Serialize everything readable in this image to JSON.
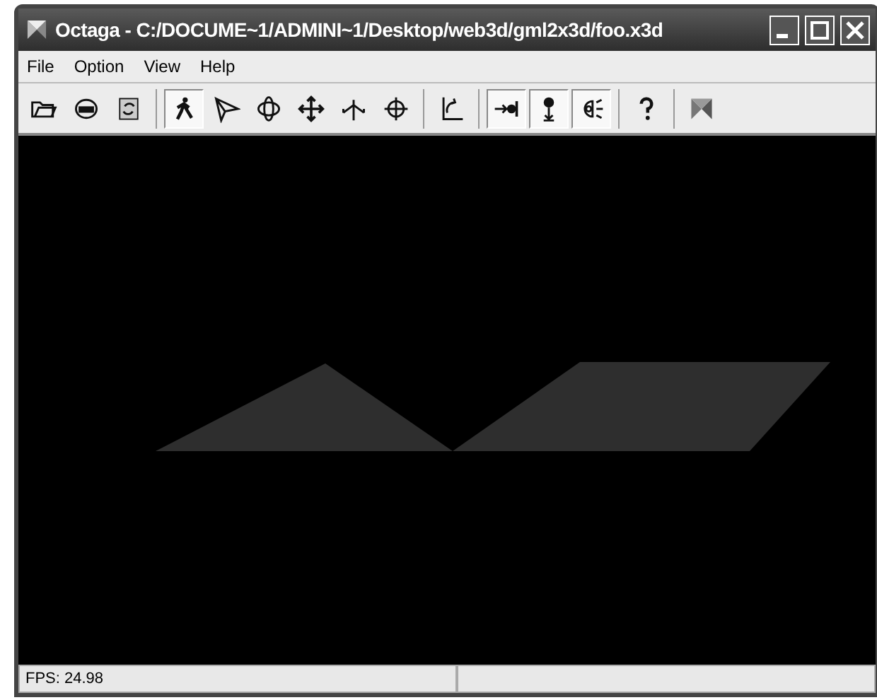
{
  "window": {
    "title": "Octaga - C:/DOCUME~1/ADMINI~1/Desktop/web3d/gml2x3d/foo.x3d"
  },
  "menu": [
    "File",
    "Option",
    "View",
    "Help"
  ],
  "toolbar": [
    [
      {
        "pressed": false
      },
      {
        "pressed": false
      },
      {
        "pressed": false
      }
    ],
    [
      {
        "pressed": true
      },
      {
        "pressed": false
      },
      {
        "pressed": false
      },
      {
        "pressed": false
      },
      {
        "pressed": false
      },
      {
        "pressed": false
      }
    ],
    [
      {
        "pressed": false
      }
    ],
    [
      {
        "pressed": true
      },
      {
        "pressed": true
      },
      {
        "pressed": true
      }
    ],
    [
      {
        "pressed": false
      }
    ],
    [
      {
        "pressed": false
      }
    ]
  ],
  "status_bar": {
    "text": "FPS: 24.98"
  }
}
